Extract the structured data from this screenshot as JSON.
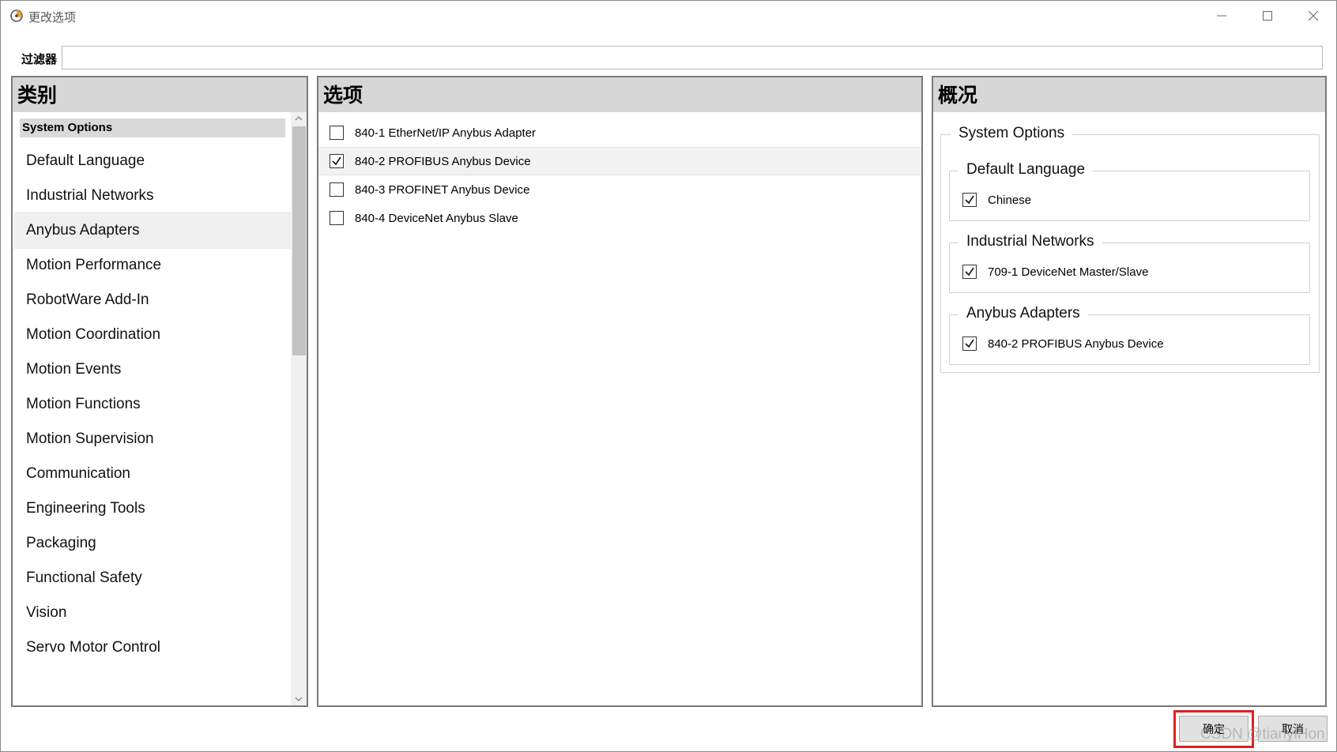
{
  "window": {
    "title": "更改选项",
    "icon": "app-logo-icon",
    "controls": [
      "minimize-icon",
      "maximize-icon",
      "close-icon"
    ]
  },
  "filter": {
    "label": "过滤器",
    "value": ""
  },
  "categories": {
    "header": "类别",
    "group_label": "System Options",
    "items": [
      {
        "label": "Default Language",
        "selected": false
      },
      {
        "label": "Industrial Networks",
        "selected": false
      },
      {
        "label": "Anybus Adapters",
        "selected": true
      },
      {
        "label": "Motion Performance",
        "selected": false
      },
      {
        "label": "RobotWare Add-In",
        "selected": false
      },
      {
        "label": "Motion Coordination",
        "selected": false
      },
      {
        "label": "Motion Events",
        "selected": false
      },
      {
        "label": "Motion Functions",
        "selected": false
      },
      {
        "label": "Motion Supervision",
        "selected": false
      },
      {
        "label": "Communication",
        "selected": false
      },
      {
        "label": "Engineering Tools",
        "selected": false
      },
      {
        "label": "Packaging",
        "selected": false
      },
      {
        "label": "Functional Safety",
        "selected": false
      },
      {
        "label": "Vision",
        "selected": false
      },
      {
        "label": "Servo Motor Control",
        "selected": false
      }
    ]
  },
  "options": {
    "header": "选项",
    "items": [
      {
        "label": "840-1 EtherNet/IP Anybus Adapter",
        "checked": false,
        "selected": false
      },
      {
        "label": "840-2 PROFIBUS Anybus Device",
        "checked": true,
        "selected": true
      },
      {
        "label": "840-3 PROFINET Anybus Device",
        "checked": false,
        "selected": false
      },
      {
        "label": "840-4 DeviceNet Anybus Slave",
        "checked": false,
        "selected": false
      }
    ]
  },
  "summary": {
    "header": "概况",
    "group_label": "System Options",
    "sections": [
      {
        "title": "Default Language",
        "items": [
          {
            "label": "Chinese",
            "checked": true
          }
        ]
      },
      {
        "title": "Industrial Networks",
        "items": [
          {
            "label": "709-1 DeviceNet Master/Slave",
            "checked": true
          }
        ]
      },
      {
        "title": "Anybus Adapters",
        "items": [
          {
            "label": "840-2 PROFIBUS Anybus Device",
            "checked": true
          }
        ]
      }
    ]
  },
  "buttons": {
    "ok_label": "确定",
    "cancel_label": "取消"
  },
  "watermark": "CSDN @tianyiHon",
  "colors": {
    "header_bg": "#d6d6d6",
    "highlight_border": "#e02020"
  }
}
